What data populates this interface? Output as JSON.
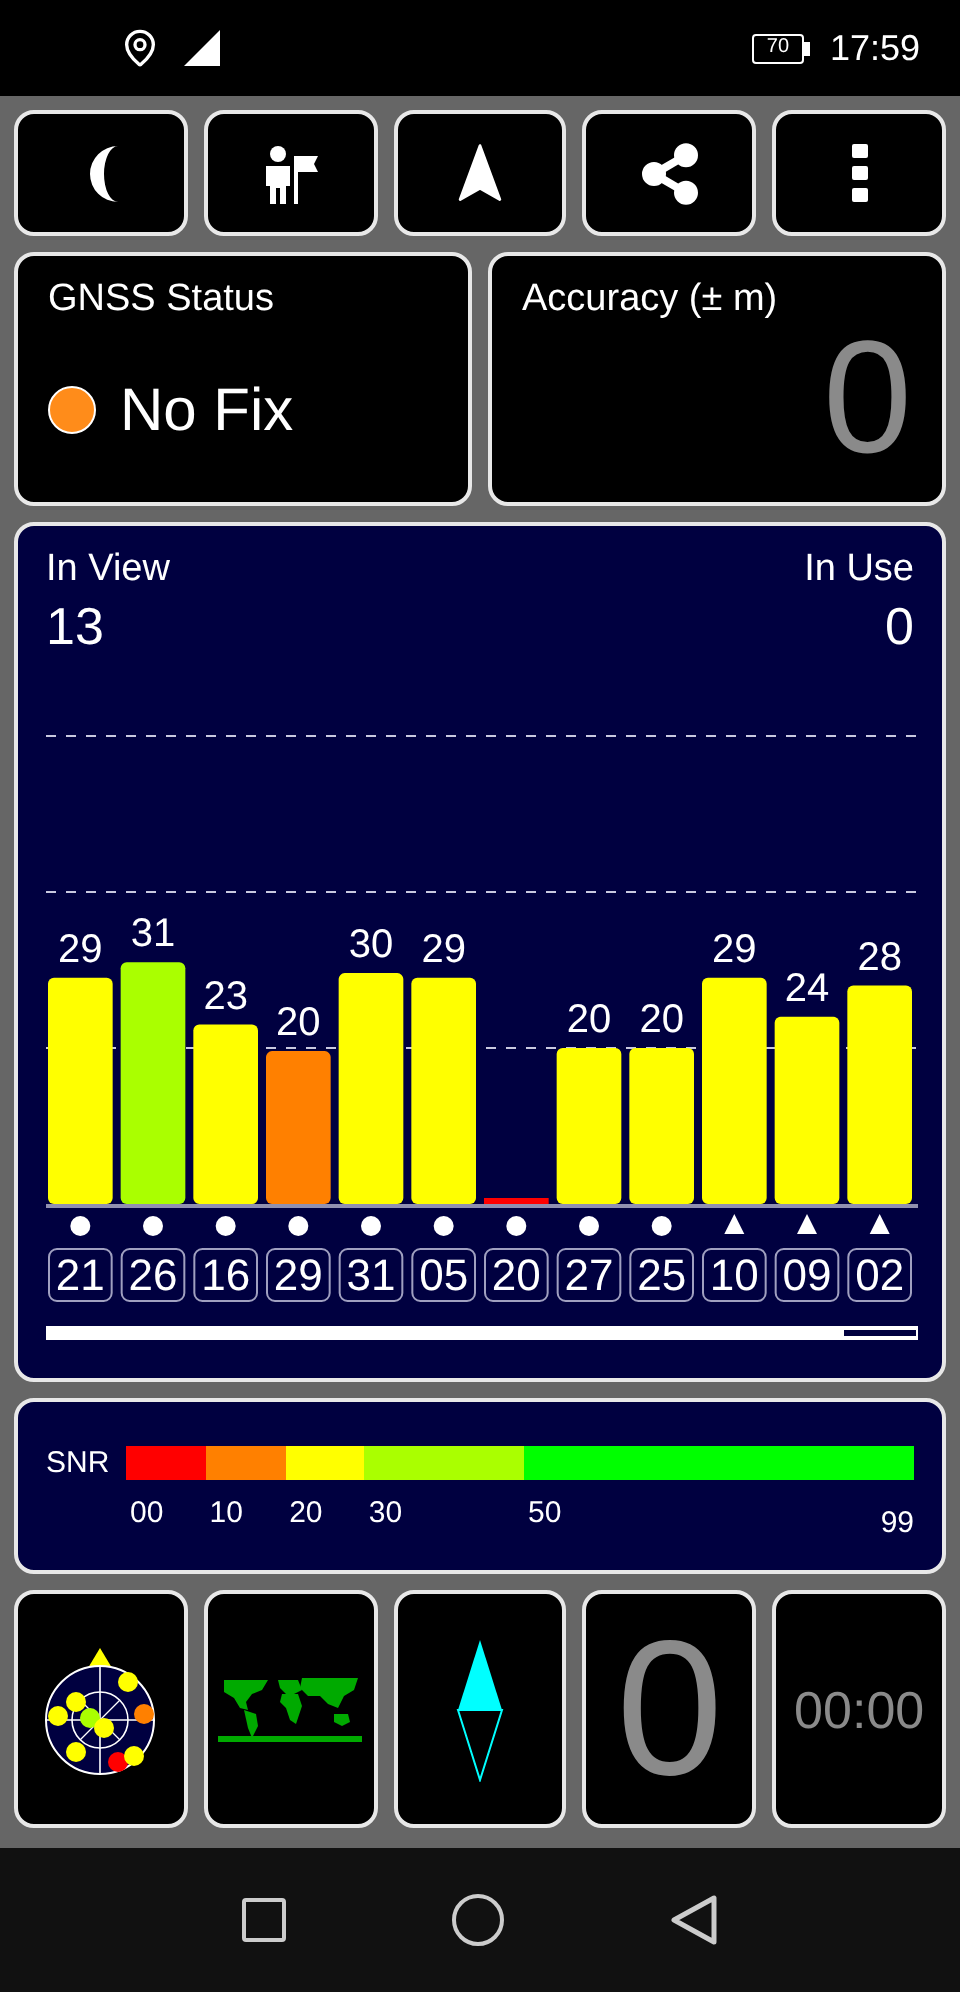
{
  "status_bar": {
    "battery": "70",
    "time": "17:59"
  },
  "gnss_status": {
    "title": "GNSS Status",
    "fix": "No Fix"
  },
  "accuracy": {
    "title": "Accuracy (± m)",
    "value": "0"
  },
  "satellites": {
    "in_view_label": "In View",
    "in_view": "13",
    "in_use_label": "In Use",
    "in_use": "0",
    "chart_data": {
      "type": "bar",
      "categories": [
        "21",
        "26",
        "16",
        "29",
        "31",
        "05",
        "20",
        "27",
        "25",
        "10",
        "09",
        "02"
      ],
      "values": [
        29,
        31,
        23,
        19.6,
        29.6,
        29,
        0,
        20,
        20,
        29,
        24,
        28
      ],
      "value_labels": [
        "29",
        "31",
        "23",
        "20",
        "30",
        "29",
        null,
        "20",
        "20",
        "29",
        "24",
        "28"
      ],
      "data_labels": true
    },
    "grid_lines": true,
    "markers": [
      {
        "kind": "circle"
      },
      {
        "kind": "circle"
      },
      {
        "kind": "circle"
      },
      {
        "kind": "circle"
      },
      {
        "kind": "circle"
      },
      {
        "kind": "circle"
      },
      {
        "kind": "circle"
      },
      {
        "kind": "circle"
      },
      {
        "kind": "circle"
      },
      {
        "kind": "triangle"
      },
      {
        "kind": "triangle"
      },
      {
        "kind": "triangle"
      }
    ]
  },
  "snr_legend": {
    "label": "SNR",
    "segments": [
      {
        "start": "00",
        "color": "#ff0000"
      },
      {
        "start": "10",
        "color": "#ff8000"
      },
      {
        "start": "20",
        "color": "#ffff00"
      },
      {
        "start": "30",
        "color": "#aaff00"
      },
      {
        "start": "50",
        "color": "#00ff00"
      }
    ],
    "end": "99"
  },
  "tiles": [
    {
      "kind": "skyplot"
    },
    {
      "kind": "map"
    },
    {
      "kind": "compass"
    },
    {
      "kind": "count",
      "text": "0"
    },
    {
      "kind": "timer",
      "text": "00:00"
    }
  ]
}
